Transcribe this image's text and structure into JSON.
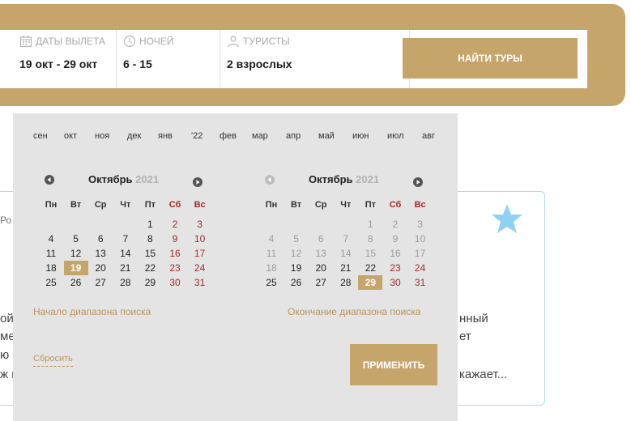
{
  "search": {
    "dates_label": "ДАТЫ ВЫЛЕТА",
    "dates_value": "19 окт - 29 окт",
    "nights_label": "НОЧЕЙ",
    "nights_value": "6 - 15",
    "tourists_label": "ТУРИСТЫ",
    "tourists_value": "2 взрослых",
    "find_button": "НАЙТИ ТУРЫ"
  },
  "background": {
    "left_fragments": [
      "Ро",
      "ой",
      "ме",
      "ю",
      "ж к"
    ],
    "right_fragments": [
      "нный",
      "ет",
      "кажает..."
    ]
  },
  "calendar": {
    "months": [
      "сен",
      "окт",
      "ноя",
      "дек",
      "янв",
      "'22",
      "фев",
      "мар",
      "апр",
      "май",
      "июн",
      "июл",
      "авг"
    ],
    "weekdays": [
      "Пн",
      "Вт",
      "Ср",
      "Чт",
      "Пт",
      "Сб",
      "Вс"
    ],
    "left": {
      "title": "Октябрь",
      "year": "2021",
      "selected_day": "19",
      "weeks": [
        [
          "",
          "",
          "",
          "",
          "1",
          "2",
          "3"
        ],
        [
          "4",
          "5",
          "6",
          "7",
          "8",
          "9",
          "10"
        ],
        [
          "11",
          "12",
          "13",
          "14",
          "15",
          "16",
          "17"
        ],
        [
          "18",
          "19",
          "20",
          "21",
          "22",
          "23",
          "24"
        ],
        [
          "25",
          "26",
          "27",
          "28",
          "29",
          "30",
          "31"
        ]
      ]
    },
    "right": {
      "title": "Октябрь",
      "year": "2021",
      "selected_day": "29",
      "last_disabled_day": "18",
      "weeks": [
        [
          "",
          "",
          "",
          "",
          "1",
          "2",
          "3"
        ],
        [
          "4",
          "5",
          "6",
          "7",
          "8",
          "9",
          "10"
        ],
        [
          "11",
          "12",
          "13",
          "14",
          "15",
          "16",
          "17"
        ],
        [
          "18",
          "19",
          "20",
          "21",
          "22",
          "23",
          "24"
        ],
        [
          "25",
          "26",
          "27",
          "28",
          "29",
          "30",
          "31"
        ]
      ]
    },
    "range_start_label": "Начало диапазона поиска",
    "range_end_label": "Окончание диапазона поиска",
    "reset_label": "Сбросить",
    "apply_label": "ПРИМЕНИТЬ"
  }
}
